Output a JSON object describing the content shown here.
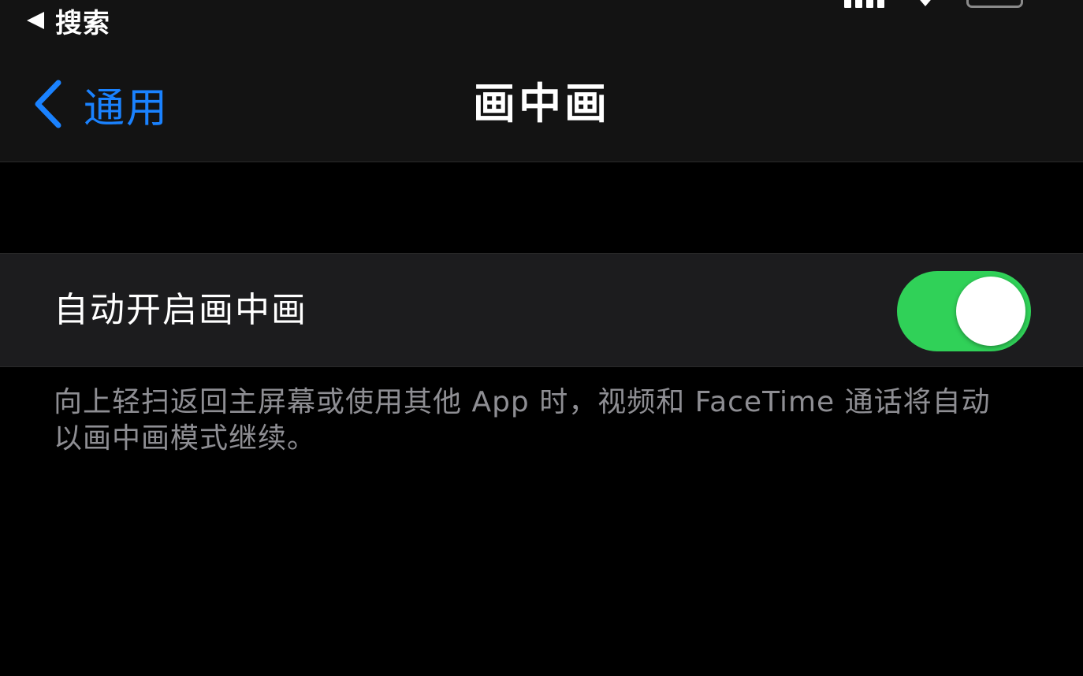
{
  "status_bar": {
    "back_label": "搜索"
  },
  "nav": {
    "back_label": "通用",
    "title": "画中画"
  },
  "settings": {
    "auto_pip": {
      "label": "自动开启画中画",
      "enabled": true
    },
    "footer": "向上轻扫返回主屏幕或使用其他 App 时，视频和 FaceTime 通话将自动以画中画模式继续。"
  },
  "colors": {
    "accent": "#1a82ff",
    "toggle_on": "#30d158",
    "secondary_text": "#8e8e93",
    "cell_background": "#1c1c1e"
  },
  "icons": {
    "status_back": "back-triangle-icon",
    "nav_back": "chevron-left-icon",
    "signal": "cellular-signal-icon",
    "wifi": "wifi-icon",
    "battery": "battery-icon"
  }
}
